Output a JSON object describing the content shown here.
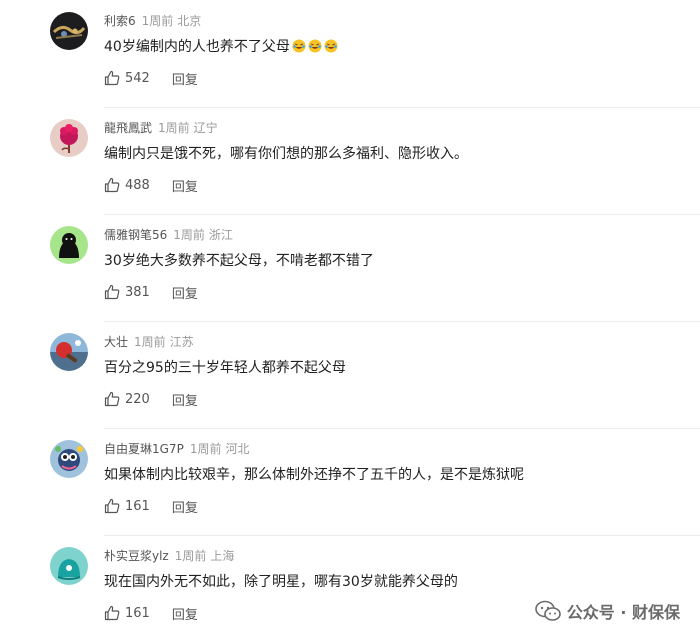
{
  "comments": [
    {
      "user": "利索6",
      "time": "1周前",
      "location": "北京",
      "text": "40岁编制内的人也养不了父母",
      "emoji_count": 3,
      "likes": "542",
      "reply": "回复",
      "avatar": "dark-decor"
    },
    {
      "user": "龍飛鳳武",
      "time": "1周前",
      "location": "辽宁",
      "text": "编制内只是饿不死，哪有你们想的那么多福利、隐形收入。",
      "likes": "488",
      "reply": "回复",
      "avatar": "pink-flower"
    },
    {
      "user": "儒雅钢笔56",
      "time": "1周前",
      "location": "浙江",
      "text": "30岁绝大多数养不起父母，不啃老都不错了",
      "likes": "381",
      "reply": "回复",
      "avatar": "green-blob"
    },
    {
      "user": "大壮",
      "time": "1周前",
      "location": "江苏",
      "text": "百分之95的三十岁年轻人都养不起父母",
      "likes": "220",
      "reply": "回复",
      "avatar": "pingpong"
    },
    {
      "user": "自由夏琳1G7P",
      "time": "1周前",
      "location": "河北",
      "text": "如果体制内比较艰辛，那么体制外还挣不了五千的人，是不是炼狱呢",
      "likes": "161",
      "reply": "回复",
      "avatar": "cartoon"
    },
    {
      "user": "朴实豆浆ylz",
      "time": "1周前",
      "location": "上海",
      "text": "现在国内外无不如此，除了明星，哪有30岁就能养父母的",
      "likes": "161",
      "reply": "回复",
      "avatar": "teal-blob"
    }
  ],
  "watermark": {
    "text": "公众号 · 财保保",
    "icon": "wechat-icon"
  }
}
